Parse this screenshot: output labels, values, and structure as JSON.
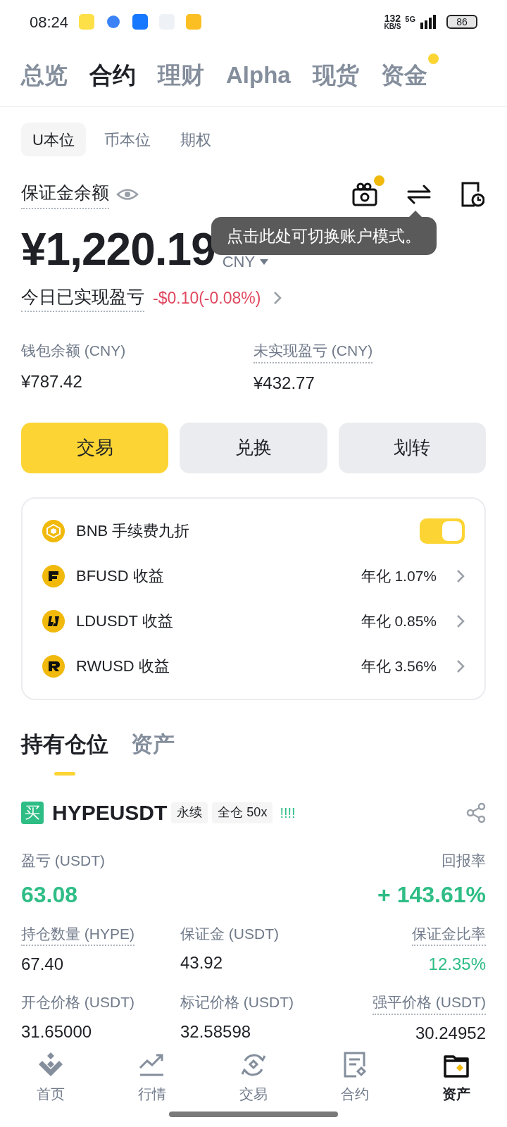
{
  "status_bar": {
    "time": "08:24",
    "speed": "132",
    "speed_unit": "KB/S",
    "network": "5G",
    "battery": "86"
  },
  "top_tabs": [
    {
      "label": "总览",
      "selected": false,
      "dot": false
    },
    {
      "label": "合约",
      "selected": true,
      "dot": false
    },
    {
      "label": "理财",
      "selected": false,
      "dot": false
    },
    {
      "label": "Alpha",
      "selected": false,
      "dot": false
    },
    {
      "label": "现货",
      "selected": false,
      "dot": false
    },
    {
      "label": "资金",
      "selected": false,
      "dot": true
    }
  ],
  "sub_tabs": [
    {
      "label": "U本位",
      "selected": true
    },
    {
      "label": "币本位",
      "selected": false
    },
    {
      "label": "期权",
      "selected": false
    }
  ],
  "balance": {
    "label": "保证金余额",
    "amount": "¥1,220.19",
    "currency": "CNY",
    "tooltip": "点击此处可切换账户模式。",
    "gift_dot": true
  },
  "today_pnl": {
    "label": "今日已实现盈亏",
    "value": "-$0.10(-0.08%)"
  },
  "stats": [
    {
      "label": "钱包余额 (CNY)",
      "value": "¥787.42",
      "dotted": false
    },
    {
      "label": "未实现盈亏 (CNY)",
      "value": "¥432.77",
      "dotted": true
    }
  ],
  "actions": [
    {
      "label": "交易",
      "primary": true
    },
    {
      "label": "兑换",
      "primary": false
    },
    {
      "label": "划转",
      "primary": false
    }
  ],
  "earn_card": [
    {
      "kind": "toggle",
      "label": "BNB 手续费九折",
      "on": true
    },
    {
      "kind": "link",
      "label": "BFUSD 收益",
      "rate": "年化 1.07%"
    },
    {
      "kind": "link",
      "label": "LDUSDT 收益",
      "rate": "年化 0.85%"
    },
    {
      "kind": "link",
      "label": "RWUSD 收益",
      "rate": "年化 3.56%"
    }
  ],
  "position_tabs": [
    {
      "label": "持有仓位",
      "selected": true
    },
    {
      "label": "资产",
      "selected": false
    }
  ],
  "position": {
    "side": "买",
    "symbol": "HYPEUSDT",
    "tags": [
      "永续",
      "全仓 50x"
    ],
    "bars": "!!!!",
    "pnl_label": "盈亏 (USDT)",
    "pnl": "63.08",
    "roe_label": "回报率",
    "roe": "+ 143.61%",
    "fields": [
      {
        "label": "持仓数量 (HYPE)",
        "value": "67.40",
        "dotted": true,
        "green": false
      },
      {
        "label": "保证金 (USDT)",
        "value": "43.92",
        "dotted": false,
        "green": false
      },
      {
        "label": "保证金比率",
        "value": "12.35%",
        "dotted": true,
        "green": true
      },
      {
        "label": "开仓价格 (USDT)",
        "value": "31.65000",
        "dotted": false,
        "green": false
      },
      {
        "label": "标记价格 (USDT)",
        "value": "32.58598",
        "dotted": false,
        "green": false
      },
      {
        "label": "强平价格 (USDT)",
        "value": "30.24952",
        "dotted": true,
        "green": false
      }
    ]
  },
  "bottom_nav": [
    {
      "label": "首页",
      "selected": false
    },
    {
      "label": "行情",
      "selected": false
    },
    {
      "label": "交易",
      "selected": false
    },
    {
      "label": "合约",
      "selected": false
    },
    {
      "label": "资产",
      "selected": true
    }
  ]
}
